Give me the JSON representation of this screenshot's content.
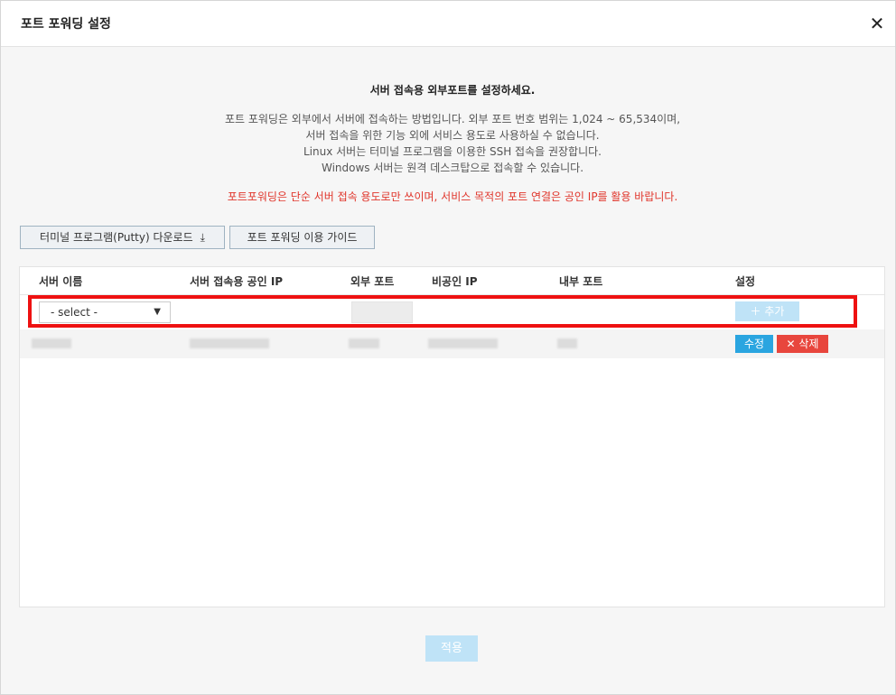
{
  "dialog": {
    "title": "포트 포워딩 설정",
    "close_label": "✕"
  },
  "intro": {
    "title": "서버 접속용 외부포트를 설정하세요.",
    "lines": [
      "포트 포워딩은 외부에서 서버에 접속하는 방법입니다. 외부 포트 번호 범위는 1,024 ~ 65,534이며,",
      "서버 접속을 위한 기능 외에 서비스 용도로 사용하실 수 없습니다.",
      "Linux 서버는 터미널 프로그램을 이용한 SSH 접속을 권장합니다.",
      "Windows 서버는 원격 데스크탑으로 접속할 수 있습니다."
    ],
    "warning": "포트포워딩은 단순 서버 접속 용도로만 쓰이며, 서비스 목적의 포트 연결은 공인 IP를 활용 바랍니다."
  },
  "toolbar": {
    "download_label": "터미널 프로그램(Putty) 다운로드",
    "download_icon": "⤓",
    "guide_label": "포트 포워딩 이용 가이드"
  },
  "table": {
    "headers": {
      "server_name": "서버 이름",
      "public_ip": "서버 접속용 공인 IP",
      "external_port": "외부 포트",
      "private_ip": "비공인 IP",
      "internal_port": "내부 포트",
      "settings": "설정"
    },
    "input_row": {
      "select_value": "- select -",
      "select_arrow": "▼",
      "add_label": "＋ 추가"
    },
    "data_row": {
      "edit_label": "수정",
      "delete_label": "✕ 삭제"
    }
  },
  "footer": {
    "apply_label": "적용"
  },
  "colors": {
    "highlight": "#ee1111",
    "warning": "#e0352b",
    "edit": "#2aa5e0",
    "delete": "#e8463d",
    "disabled": "#bfe3f7"
  }
}
